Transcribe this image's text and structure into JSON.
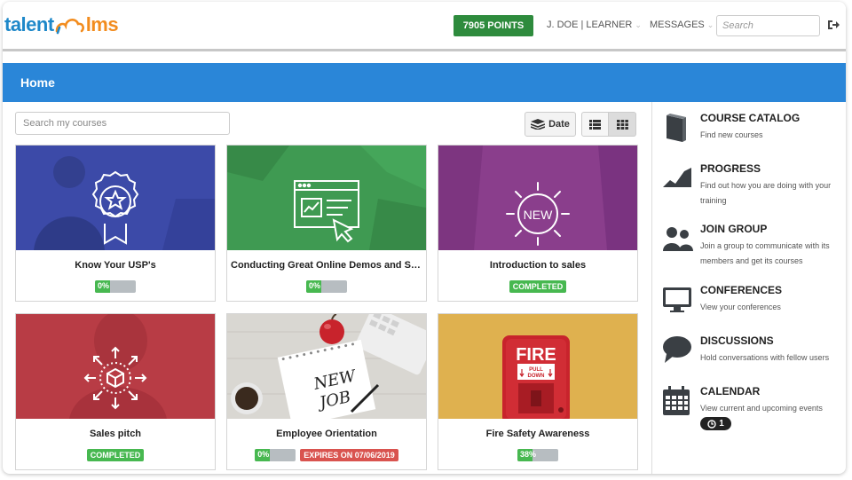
{
  "header": {
    "logo_left": "talent",
    "logo_right": "lms",
    "points": "7905 POINTS",
    "user_menu": "J. DOE | LEARNER",
    "messages_menu": "MESSAGES",
    "search_placeholder": "Search"
  },
  "page": {
    "title": "Home"
  },
  "toolbar": {
    "search_placeholder": "Search my courses",
    "sort_label": "Date"
  },
  "courses": [
    {
      "title": "Know Your USP's",
      "progress_label": "0%",
      "progress": 0,
      "status": "",
      "expires": ""
    },
    {
      "title": "Conducting Great Online Demos and Sal...",
      "progress_label": "0%",
      "progress": 0,
      "status": "",
      "expires": ""
    },
    {
      "title": "Introduction to sales",
      "progress_label": "",
      "progress": 100,
      "status": "COMPLETED",
      "expires": ""
    },
    {
      "title": "Sales pitch",
      "progress_label": "",
      "progress": 100,
      "status": "COMPLETED",
      "expires": ""
    },
    {
      "title": "Employee Orientation",
      "progress_label": "0%",
      "progress": 0,
      "status": "",
      "expires": "EXPIRES ON 07/06/2019"
    },
    {
      "title": "Fire Safety Awareness",
      "progress_label": "38%",
      "progress": 38,
      "status": "",
      "expires": ""
    }
  ],
  "thumb_text": {
    "new": "NEW",
    "fire": "FIRE",
    "pull": "PULL",
    "down": "DOWN",
    "new_job_1": "NEW",
    "new_job_2": "JOB"
  },
  "sidebar": [
    {
      "title": "COURSE CATALOG",
      "desc": "Find new courses",
      "icon": "book-icon"
    },
    {
      "title": "PROGRESS",
      "desc": "Find out how you are doing with your training",
      "icon": "chart-icon"
    },
    {
      "title": "JOIN GROUP",
      "desc": "Join a group to communicate with its members and get its courses",
      "icon": "group-icon"
    },
    {
      "title": "CONFERENCES",
      "desc": "View your conferences",
      "icon": "monitor-icon"
    },
    {
      "title": "DISCUSSIONS",
      "desc": "Hold conversations with fellow users",
      "icon": "speech-bubble-icon"
    },
    {
      "title": "CALENDAR",
      "desc": "View current and upcoming events",
      "icon": "calendar-icon",
      "badge": "1"
    }
  ],
  "colors": {
    "brand_blue": "#2a86d8",
    "points_green": "#2e8b3d",
    "complete_green": "#47b850",
    "expire_red": "#d9534f"
  }
}
